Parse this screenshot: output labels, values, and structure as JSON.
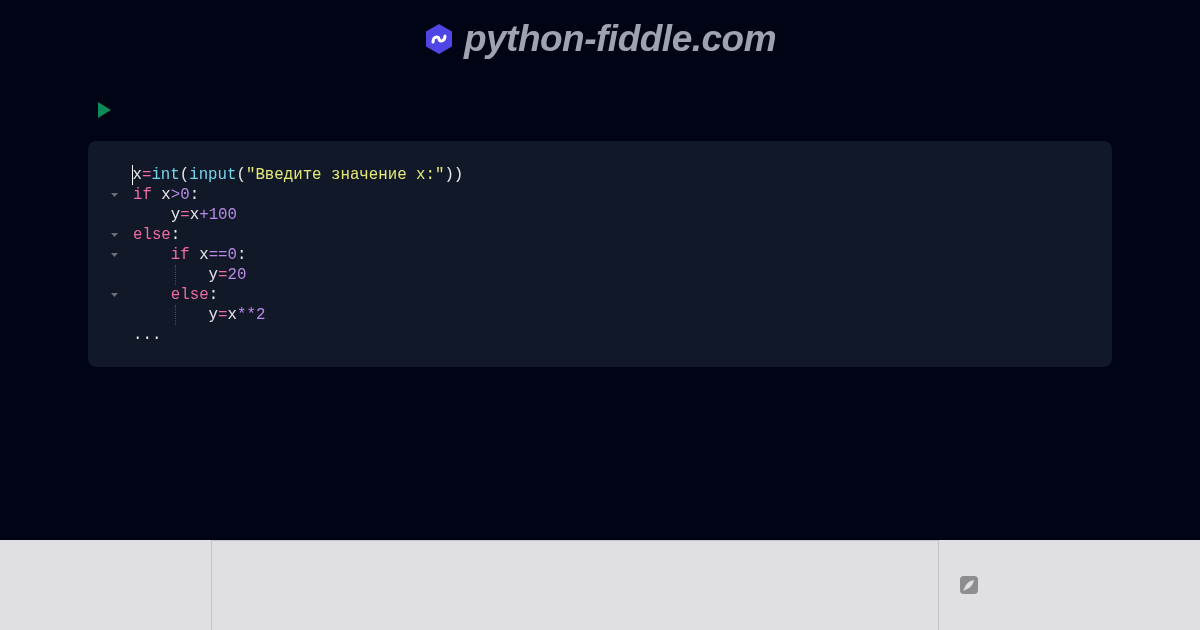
{
  "header": {
    "site_title": "python-fiddle.com"
  },
  "editor": {
    "lines": [
      {
        "foldable": false,
        "guide": false,
        "cursor": true,
        "tokens": [
          {
            "kind": "var",
            "text": "x"
          },
          {
            "kind": "assign",
            "text": "="
          },
          {
            "kind": "builtin",
            "text": "int"
          },
          {
            "kind": "punct",
            "text": "("
          },
          {
            "kind": "builtin",
            "text": "input"
          },
          {
            "kind": "punct",
            "text": "("
          },
          {
            "kind": "string",
            "text": "\"Введите значение x:\""
          },
          {
            "kind": "punct",
            "text": "))"
          }
        ]
      },
      {
        "foldable": true,
        "guide": false,
        "cursor": false,
        "tokens": [
          {
            "kind": "keyword",
            "text": "if"
          },
          {
            "kind": "var",
            "text": " x"
          },
          {
            "kind": "op",
            "text": ">"
          },
          {
            "kind": "number",
            "text": "0"
          },
          {
            "kind": "punct",
            "text": ":"
          }
        ]
      },
      {
        "foldable": false,
        "guide": false,
        "cursor": false,
        "tokens": [
          {
            "kind": "var",
            "text": "    y"
          },
          {
            "kind": "assign",
            "text": "="
          },
          {
            "kind": "var",
            "text": "x"
          },
          {
            "kind": "op",
            "text": "+"
          },
          {
            "kind": "number",
            "text": "100"
          }
        ]
      },
      {
        "foldable": true,
        "guide": false,
        "cursor": false,
        "tokens": [
          {
            "kind": "keyword",
            "text": "else"
          },
          {
            "kind": "punct",
            "text": ":"
          }
        ]
      },
      {
        "foldable": true,
        "guide": false,
        "cursor": false,
        "tokens": [
          {
            "kind": "keyword",
            "text": "    if"
          },
          {
            "kind": "var",
            "text": " x"
          },
          {
            "kind": "op",
            "text": "=="
          },
          {
            "kind": "number",
            "text": "0"
          },
          {
            "kind": "punct",
            "text": ":"
          }
        ]
      },
      {
        "foldable": false,
        "guide": true,
        "cursor": false,
        "tokens": [
          {
            "kind": "var",
            "text": "        y"
          },
          {
            "kind": "assign",
            "text": "="
          },
          {
            "kind": "number",
            "text": "20"
          }
        ]
      },
      {
        "foldable": true,
        "guide": false,
        "cursor": false,
        "tokens": [
          {
            "kind": "keyword",
            "text": "    else"
          },
          {
            "kind": "punct",
            "text": ":"
          }
        ]
      },
      {
        "foldable": false,
        "guide": true,
        "cursor": false,
        "tokens": [
          {
            "kind": "var",
            "text": "        y"
          },
          {
            "kind": "assign",
            "text": "="
          },
          {
            "kind": "var",
            "text": "x"
          },
          {
            "kind": "op",
            "text": "**"
          },
          {
            "kind": "number",
            "text": "2"
          }
        ]
      },
      {
        "foldable": false,
        "guide": false,
        "cursor": false,
        "tokens": [
          {
            "kind": "punct",
            "text": "..."
          }
        ]
      }
    ]
  }
}
